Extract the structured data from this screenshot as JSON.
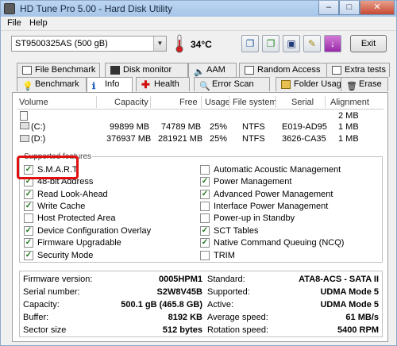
{
  "window": {
    "title": "HD Tune Pro 5.00 - Hard Disk Utility",
    "min": "–",
    "max": "□",
    "close": "✕"
  },
  "menu": {
    "file": "File",
    "help": "Help"
  },
  "toolbar": {
    "drive": "ST9500325AS (500 gB)",
    "temperature": "34°C",
    "exit_label": "Exit",
    "buttons": [
      "copy-icon",
      "save-icon",
      "disk-save-icon",
      "options-icon",
      "download-icon"
    ]
  },
  "tabs_row1": [
    {
      "label": "File Benchmark",
      "icon": "file-benchmark-icon"
    },
    {
      "label": "Disk monitor",
      "icon": "disk-monitor-icon"
    },
    {
      "label": "AAM",
      "icon": "aam-icon"
    },
    {
      "label": "Random Access",
      "icon": "random-access-icon"
    },
    {
      "label": "Extra tests",
      "icon": "extra-tests-icon"
    }
  ],
  "tabs_row2": [
    {
      "label": "Benchmark",
      "icon": "benchmark-icon"
    },
    {
      "label": "Info",
      "icon": "info-icon"
    },
    {
      "label": "Health",
      "icon": "health-icon"
    },
    {
      "label": "Error Scan",
      "icon": "error-scan-icon"
    },
    {
      "label": "Folder Usage",
      "icon": "folder-usage-icon"
    },
    {
      "label": "Erase",
      "icon": "erase-icon"
    }
  ],
  "volumes": {
    "headers": [
      "Volume",
      "Capacity",
      "Free",
      "Usage",
      "File system",
      "Serial",
      "Alignment"
    ],
    "rows": [
      {
        "volume": "",
        "capacity": "",
        "free": "",
        "usage": "",
        "fs": "",
        "serial": "",
        "alignment": "2 MB"
      },
      {
        "volume": "(C:)",
        "capacity": "99899 MB",
        "free": "74789 MB",
        "usage": "25%",
        "fs": "NTFS",
        "serial": "E019-AD95",
        "alignment": "1 MB"
      },
      {
        "volume": "(D:)",
        "capacity": "376937 MB",
        "free": "281921 MB",
        "usage": "25%",
        "fs": "NTFS",
        "serial": "3626-CA35",
        "alignment": "1 MB"
      }
    ]
  },
  "features": {
    "legend": "Supported features",
    "left": [
      {
        "label": "S.M.A.R.T",
        "checked": true
      },
      {
        "label": "48-bit Address",
        "checked": true
      },
      {
        "label": "Read Look-Ahead",
        "checked": true
      },
      {
        "label": "Write Cache",
        "checked": true
      },
      {
        "label": "Host Protected Area",
        "checked": false
      },
      {
        "label": "Device Configuration Overlay",
        "checked": true
      },
      {
        "label": "Firmware Upgradable",
        "checked": true
      },
      {
        "label": "Security Mode",
        "checked": true
      }
    ],
    "right": [
      {
        "label": "Automatic Acoustic Management",
        "checked": false
      },
      {
        "label": "Power Management",
        "checked": true
      },
      {
        "label": "Advanced Power Management",
        "checked": true
      },
      {
        "label": "Interface Power Management",
        "checked": false
      },
      {
        "label": "Power-up in Standby",
        "checked": false
      },
      {
        "label": "SCT Tables",
        "checked": true
      },
      {
        "label": "Native Command Queuing (NCQ)",
        "checked": true
      },
      {
        "label": "TRIM",
        "checked": false
      }
    ]
  },
  "info_left": [
    {
      "label": "Firmware version:",
      "value": "0005HPM1"
    },
    {
      "label": "Serial number:",
      "value": "S2W8V45B"
    },
    {
      "label": "Capacity:",
      "value": "500.1 gB (465.8 GB)"
    },
    {
      "label": "Buffer:",
      "value": "8192 KB"
    },
    {
      "label": "Sector size",
      "value": "512 bytes"
    }
  ],
  "info_right": [
    {
      "label": "Standard:",
      "value": "ATA8-ACS - SATA II"
    },
    {
      "label": "Supported:",
      "value": "UDMA Mode 5"
    },
    {
      "label": "Active:",
      "value": "UDMA Mode 5"
    },
    {
      "label": "Average speed:",
      "value": "61 MB/s"
    },
    {
      "label": "Rotation speed:",
      "value": "5400 RPM"
    }
  ],
  "colors": {
    "highlight": "#e01010",
    "check": "#1a7a1a"
  }
}
